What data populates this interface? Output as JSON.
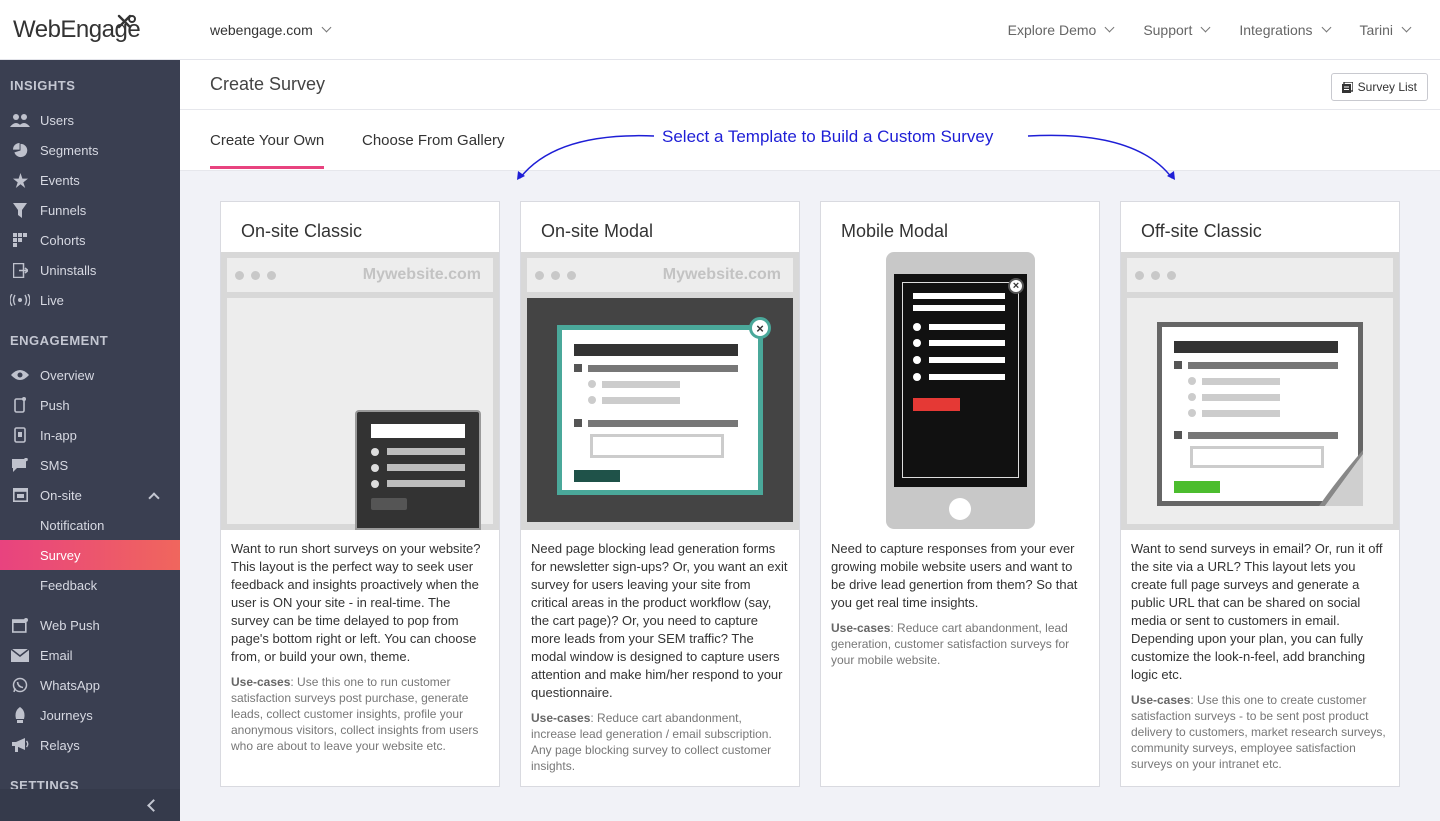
{
  "header": {
    "logo_text": "WebEngage",
    "domain": "webengage.com",
    "nav": [
      "Explore Demo",
      "Support",
      "Integrations",
      "Tarini"
    ]
  },
  "sidebar": {
    "insights_label": "INSIGHTS",
    "insights": [
      "Users",
      "Segments",
      "Events",
      "Funnels",
      "Cohorts",
      "Uninstalls",
      "Live"
    ],
    "engagement_label": "ENGAGEMENT",
    "engagement": [
      "Overview",
      "Push",
      "In-app",
      "SMS",
      "On-site"
    ],
    "onsite_sub": [
      "Notification",
      "Survey",
      "Feedback"
    ],
    "engagement2": [
      "Web Push",
      "Email",
      "WhatsApp",
      "Journeys",
      "Relays"
    ],
    "settings_label": "SETTINGS"
  },
  "page": {
    "title": "Create Survey",
    "survey_list_button": "Survey List",
    "tabs": [
      "Create Your Own",
      "Choose From Gallery"
    ],
    "annotation": "Select a Template to Build a Custom Survey"
  },
  "mock": {
    "website_label": "Mywebsite.com"
  },
  "cards": [
    {
      "title": "On-site Classic",
      "description": "Want to run short surveys on your website? This layout is the perfect way to seek user feedback and insights proactively when the user is ON your site - in real-time. The survey can be time delayed to pop from page's bottom right or left. You can choose from, or build your own, theme.",
      "usecases_label": "Use-cases",
      "usecases": ": Use this one to run customer satisfaction surveys post purchase, generate leads, collect customer insights, profile your anonymous visitors, collect insights from users who are about to leave your website etc."
    },
    {
      "title": "On-site Modal",
      "description": "Need page blocking lead generation forms for newsletter sign-ups? Or, you want an exit survey for users leaving your site from critical areas in the product workflow (say, the cart page)? Or, you need to capture more leads from your SEM traffic? The modal window is designed to capture users attention and make him/her respond to your questionnaire.",
      "usecases_label": "Use-cases",
      "usecases": ": Reduce cart abandonment, increase lead generation / email subscription. Any page blocking survey to collect customer insights."
    },
    {
      "title": "Mobile Modal",
      "description": "Need to capture responses from your ever growing mobile website users and want to be drive lead genertion from them? So that you get real time insights.",
      "usecases_label": "Use-cases",
      "usecases": ": Reduce cart abandonment, lead generation, customer satisfaction surveys for your mobile website."
    },
    {
      "title": "Off-site Classic",
      "description": "Want to send surveys in email? Or, run it off the site via a URL? This layout lets you create full page surveys and generate a public URL that can be shared on social media or sent to customers in email. Depending upon your plan, you can fully customize the look-n-feel, add branching logic etc.",
      "usecases_label": "Use-cases",
      "usecases": ": Use this one to create customer satisfaction surveys - to be sent post product delivery to customers, market research surveys, community surveys, employee satisfaction surveys on your intranet etc."
    }
  ],
  "colors": {
    "sidebar_bg": "#3a3f51",
    "accent": "#e8437f",
    "annotation": "#1e1ed6",
    "modal_border": "#4aa89a",
    "cta_green": "#4cbd2e",
    "cta_red": "#e53935"
  }
}
